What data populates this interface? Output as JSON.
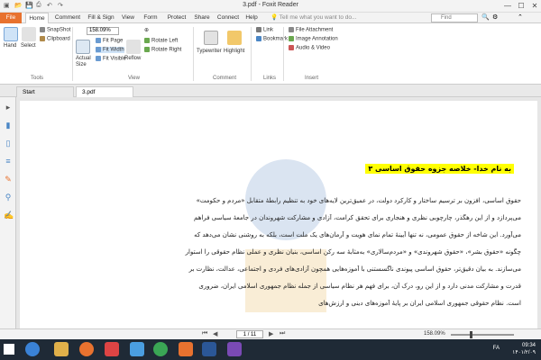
{
  "titlebar": {
    "title": "3.pdf - Foxit Reader",
    "minimize": "—",
    "maximize": "☐",
    "close": "✕"
  },
  "menu": {
    "tabs": [
      "File",
      "Home",
      "Comment",
      "Fill & Sign",
      "View",
      "Form",
      "Protect",
      "Share",
      "Connect",
      "Help"
    ],
    "active": "Home",
    "tell_me": "Tell me what you want to do...",
    "find_placeholder": "Find"
  },
  "ribbon": {
    "tools": {
      "hand": "Hand",
      "select": "Select",
      "snapshot": "SnapShot",
      "clipboard": "Clipboard",
      "group": "Tools"
    },
    "view": {
      "actual_size": "Actual Size",
      "fit_page": "Fit Page",
      "fit_width": "Fit Width",
      "fit_visible": "Fit Visible",
      "reflow": "Reflow",
      "zoom": "158.09%",
      "rotate_left": "Rotate Left",
      "rotate_right": "Rotate Right",
      "group": "View"
    },
    "comment": {
      "typewriter": "Typewriter",
      "highlight": "Highlight",
      "group": "Comment"
    },
    "links": {
      "link": "Link",
      "bookmark": "Bookmark",
      "group": "Links"
    },
    "insert": {
      "file_attachment": "File Attachment",
      "image_annotation": "Image Annotation",
      "audio_video": "Audio & Video",
      "group": "Insert"
    }
  },
  "doc_tabs": [
    "Start",
    "3.pdf"
  ],
  "document": {
    "heading": "به نام خدا-  خلاصه جزوه حقوق اساسی ۳",
    "lines": [
      "حقوق اساسی، افزون بر ترسیم ساختار و کارکرد دولت، در عمیق‌ترین لایه‌های خود به تنظیم رابطهٔ متقابل «مردم و حکومت»",
      "می‌پردازد و از این رهگذر، چارچوبی نظری و هنجاری برای تحقق کرامت، آزادی و مشارکت شهروندان در جامعهٔ سیاسی فراهم",
      "می‌آورد. این شاخه از حقوق عمومی، نه تنها آیینهٔ تمام نمای هویت و آرمان‌های یک ملت است، بلکه به روشنی نشان می‌دهد که",
      "چگونه «حقوق بشر»، «حقوق شهروندی» و «مردم‌سالاری» به‌مثابهٔ سه رکن اساسی، بنیان نظری و عملی نظام حقوقی را استوار",
      "می‌سازند. به بیان دقیق‌تر، حقوق اساسی پیوندی ناگسستنی با آموزه‌هایی همچون آزادی‌های فردی و اجتماعی، عدالت، نظارت بر",
      "قدرت و مشارکت مدنی دارد و از این رو، درک آن، برای فهم هر نظام سیاسی از جمله نظام جمهوری اسلامی ایران، ضروری",
      "است. نظام حقوقی جمهوری اسلامی ایران بر پایهٔ آموزه‌های دینی و ارزش‌های"
    ]
  },
  "statusbar": {
    "page": "1 / 11",
    "zoom": "158.09%",
    "zoom_fraction": 0.3
  },
  "taskbar": {
    "time": "09:34",
    "date": "۱۴۰۱/۲/۰۹",
    "lang": "FA"
  },
  "colors": {
    "file_tab": "#e8722f",
    "highlight": "#ffff00",
    "taskbar": "#1f2a36"
  }
}
